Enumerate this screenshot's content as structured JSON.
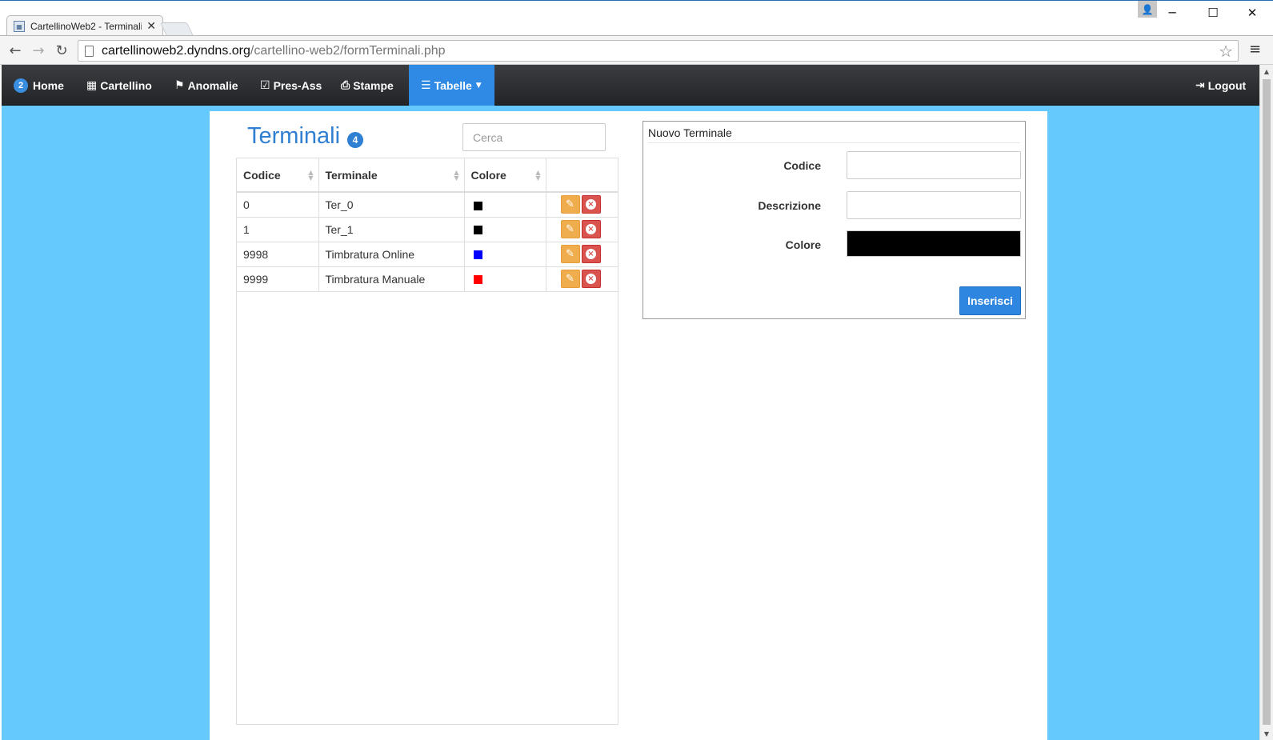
{
  "browser": {
    "tab_title": "CartellinoWeb2 - Terminali",
    "tab_close": "✕",
    "url_host": "cartellinoweb2.dyndns.org",
    "url_path": "/cartellino-web2/formTerminali.php",
    "window_controls": {
      "minimize": "─",
      "maximize": "☐",
      "close": "✕"
    },
    "back": "←",
    "forward": "→",
    "reload": "↻",
    "star": "☆",
    "menu": "≡"
  },
  "navbar": {
    "home_badge": "2",
    "home": "Home",
    "cartellino": "Cartellino",
    "anomalie": "Anomalie",
    "pres_ass": "Pres-Ass",
    "stampe": "Stampe",
    "tabelle": "Tabelle",
    "logout": "Logout",
    "active_color": "#2f8ae5"
  },
  "page": {
    "title": "Terminali",
    "count_badge": "4",
    "search_placeholder": "Cerca",
    "background_color": "#66c9fd"
  },
  "table": {
    "columns": [
      "Codice",
      "Terminale",
      "Colore",
      ""
    ],
    "rows": [
      {
        "codice": "0",
        "terminale": "Ter_0",
        "colore": "#000000"
      },
      {
        "codice": "1",
        "terminale": "Ter_1",
        "colore": "#000000"
      },
      {
        "codice": "9998",
        "terminale": "Timbratura Online",
        "colore": "#0000ff"
      },
      {
        "codice": "9999",
        "terminale": "Timbratura Manuale",
        "colore": "#ff0000"
      }
    ],
    "edit_icon": "pencil-icon",
    "delete_icon": "remove-circle-icon"
  },
  "form": {
    "legend": "Nuovo Terminale",
    "codice_label": "Codice",
    "codice_value": "",
    "descrizione_label": "Descrizione",
    "descrizione_value": "",
    "colore_label": "Colore",
    "colore_value": "#000000",
    "submit_label": "Inserisci"
  }
}
